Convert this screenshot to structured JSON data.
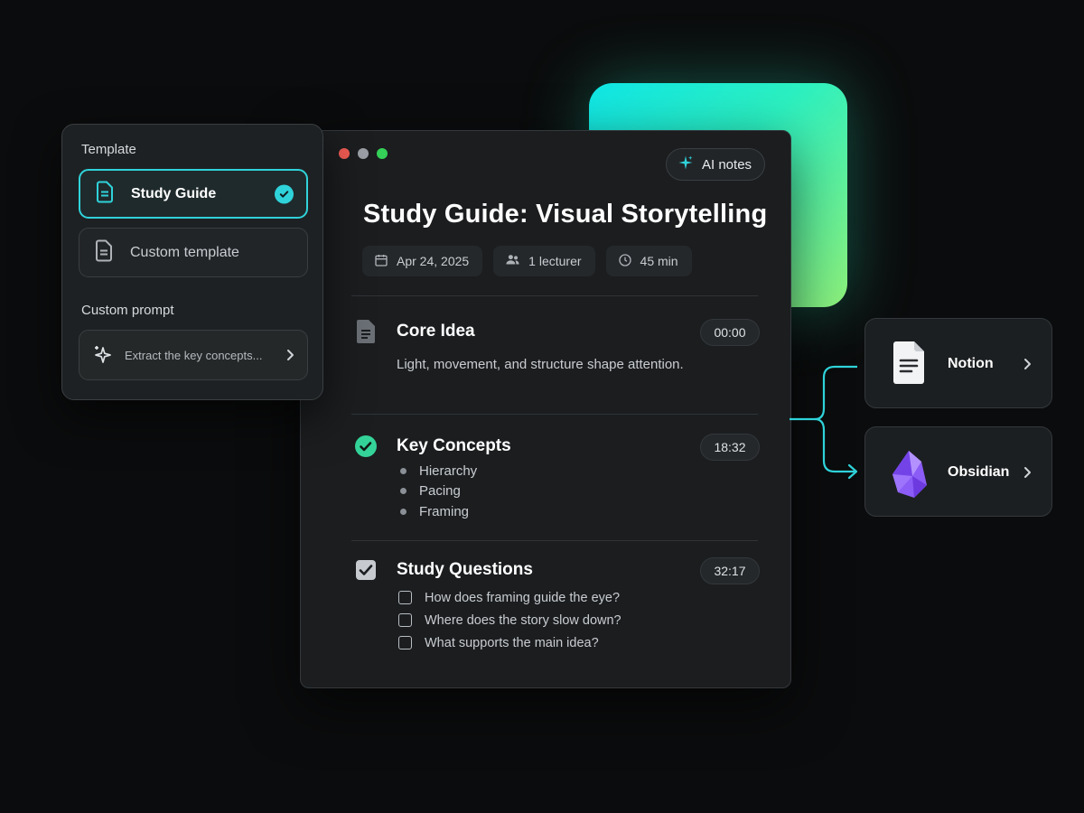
{
  "template_panel": {
    "heading": "Template",
    "options": [
      {
        "label": "Study Guide",
        "selected": true
      },
      {
        "label": "Custom template",
        "selected": false
      }
    ],
    "custom_prompt_heading": "Custom prompt",
    "custom_prompt_placeholder": "Extract the key concepts..."
  },
  "window": {
    "ai_notes_label": "AI notes",
    "title": "Study Guide: Visual Storytelling",
    "meta": {
      "date": "Apr 24, 2025",
      "people": "1 lecturer",
      "duration": "45 min"
    },
    "sections": [
      {
        "title": "Core Idea",
        "time": "00:00",
        "icon": "document-icon",
        "body": "Light, movement, and structure shape attention."
      },
      {
        "title": "Key Concepts",
        "time": "18:32",
        "icon": "check-circle-icon",
        "bullets": [
          "Hierarchy",
          "Pacing",
          "Framing"
        ]
      },
      {
        "title": "Study Questions",
        "time": "32:17",
        "icon": "checkbox-icon",
        "questions": [
          "How does framing guide the eye?",
          "Where does the story slow down?",
          "What supports the main idea?"
        ]
      }
    ]
  },
  "export_targets": [
    {
      "label": "Notion",
      "icon": "notion-doc-icon"
    },
    {
      "label": "Obsidian",
      "icon": "obsidian-crystal-icon"
    }
  ],
  "colors": {
    "accent_cyan": "#2fd3da",
    "success_green": "#34d399",
    "gradient_start": "#10e6e6",
    "gradient_end": "#8ef07a",
    "obsidian_purple": "#8b5cf6"
  }
}
